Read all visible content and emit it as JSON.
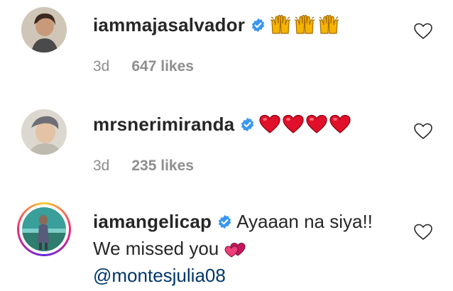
{
  "comments": [
    {
      "username": "iammajasalvador",
      "verified": true,
      "emojis": [
        "raising-hands-emoji",
        "raising-hands-emoji",
        "raising-hands-emoji"
      ],
      "time": "3d",
      "likes": "647 likes"
    },
    {
      "username": "mrsnerimiranda",
      "verified": true,
      "emojis": [
        "red-heart-emoji",
        "red-heart-emoji",
        "red-heart-emoji",
        "red-heart-emoji"
      ],
      "time": "3d",
      "likes": "235 likes"
    },
    {
      "username": "iamangelicap",
      "verified": true,
      "text_line1": "Ayaaan na siya!!",
      "text_line2": "We missed you",
      "emoji_after_line2": "two-hearts-emoji",
      "mention": "@montesjulia08"
    }
  ],
  "colors": {
    "text": "#262626",
    "meta": "#8e8e8e",
    "verified_blue": "#3897f0",
    "mention": "#00376b"
  }
}
